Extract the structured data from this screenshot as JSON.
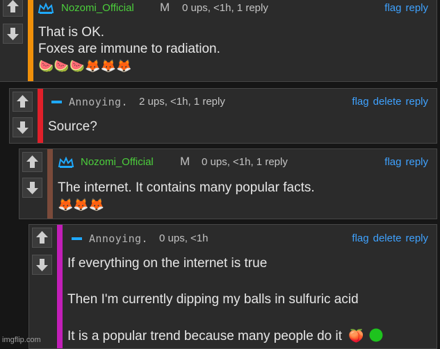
{
  "comments": [
    {
      "user": "Nozomi_Official",
      "mod": "M",
      "meta": "0 ups, <1h, 1 reply",
      "actions": [
        "flag",
        "reply"
      ],
      "lines": [
        "That is OK.",
        "Foxes are immune to radiation."
      ],
      "emojis": "🍉🍉🍉🦊🦊🦊",
      "bar_color": "#f0900a"
    },
    {
      "user": "Annoying.",
      "meta": "2 ups, <1h, 1 reply",
      "actions": [
        "flag",
        "delete",
        "reply"
      ],
      "lines": [
        "Source?"
      ],
      "bar_color": "#e0202a"
    },
    {
      "user": "Nozomi_Official",
      "mod": "M",
      "meta": "0 ups, <1h, 1 reply",
      "actions": [
        "flag",
        "reply"
      ],
      "lines": [
        "The internet. It contains many popular facts."
      ],
      "emojis": "🦊🦊🦊",
      "bar_color": "#7a4a3a"
    },
    {
      "user": "Annoying.",
      "meta": "0 ups, <1h",
      "actions": [
        "flag",
        "delete",
        "reply"
      ],
      "lines": [
        "If everything on the internet is true",
        "",
        "Then I'm currently dipping my balls in sulfuric acid",
        "",
        "It is a popular trend because many people do it"
      ],
      "emojis": "🍑",
      "bar_color": "#c21fb8"
    }
  ],
  "watermark": "imgflip.com",
  "colors": {
    "link": "#3fa2ff",
    "official": "#4ccf3c",
    "anon_badge": "#1fa9ff",
    "green_circle": "#1ec31e"
  }
}
